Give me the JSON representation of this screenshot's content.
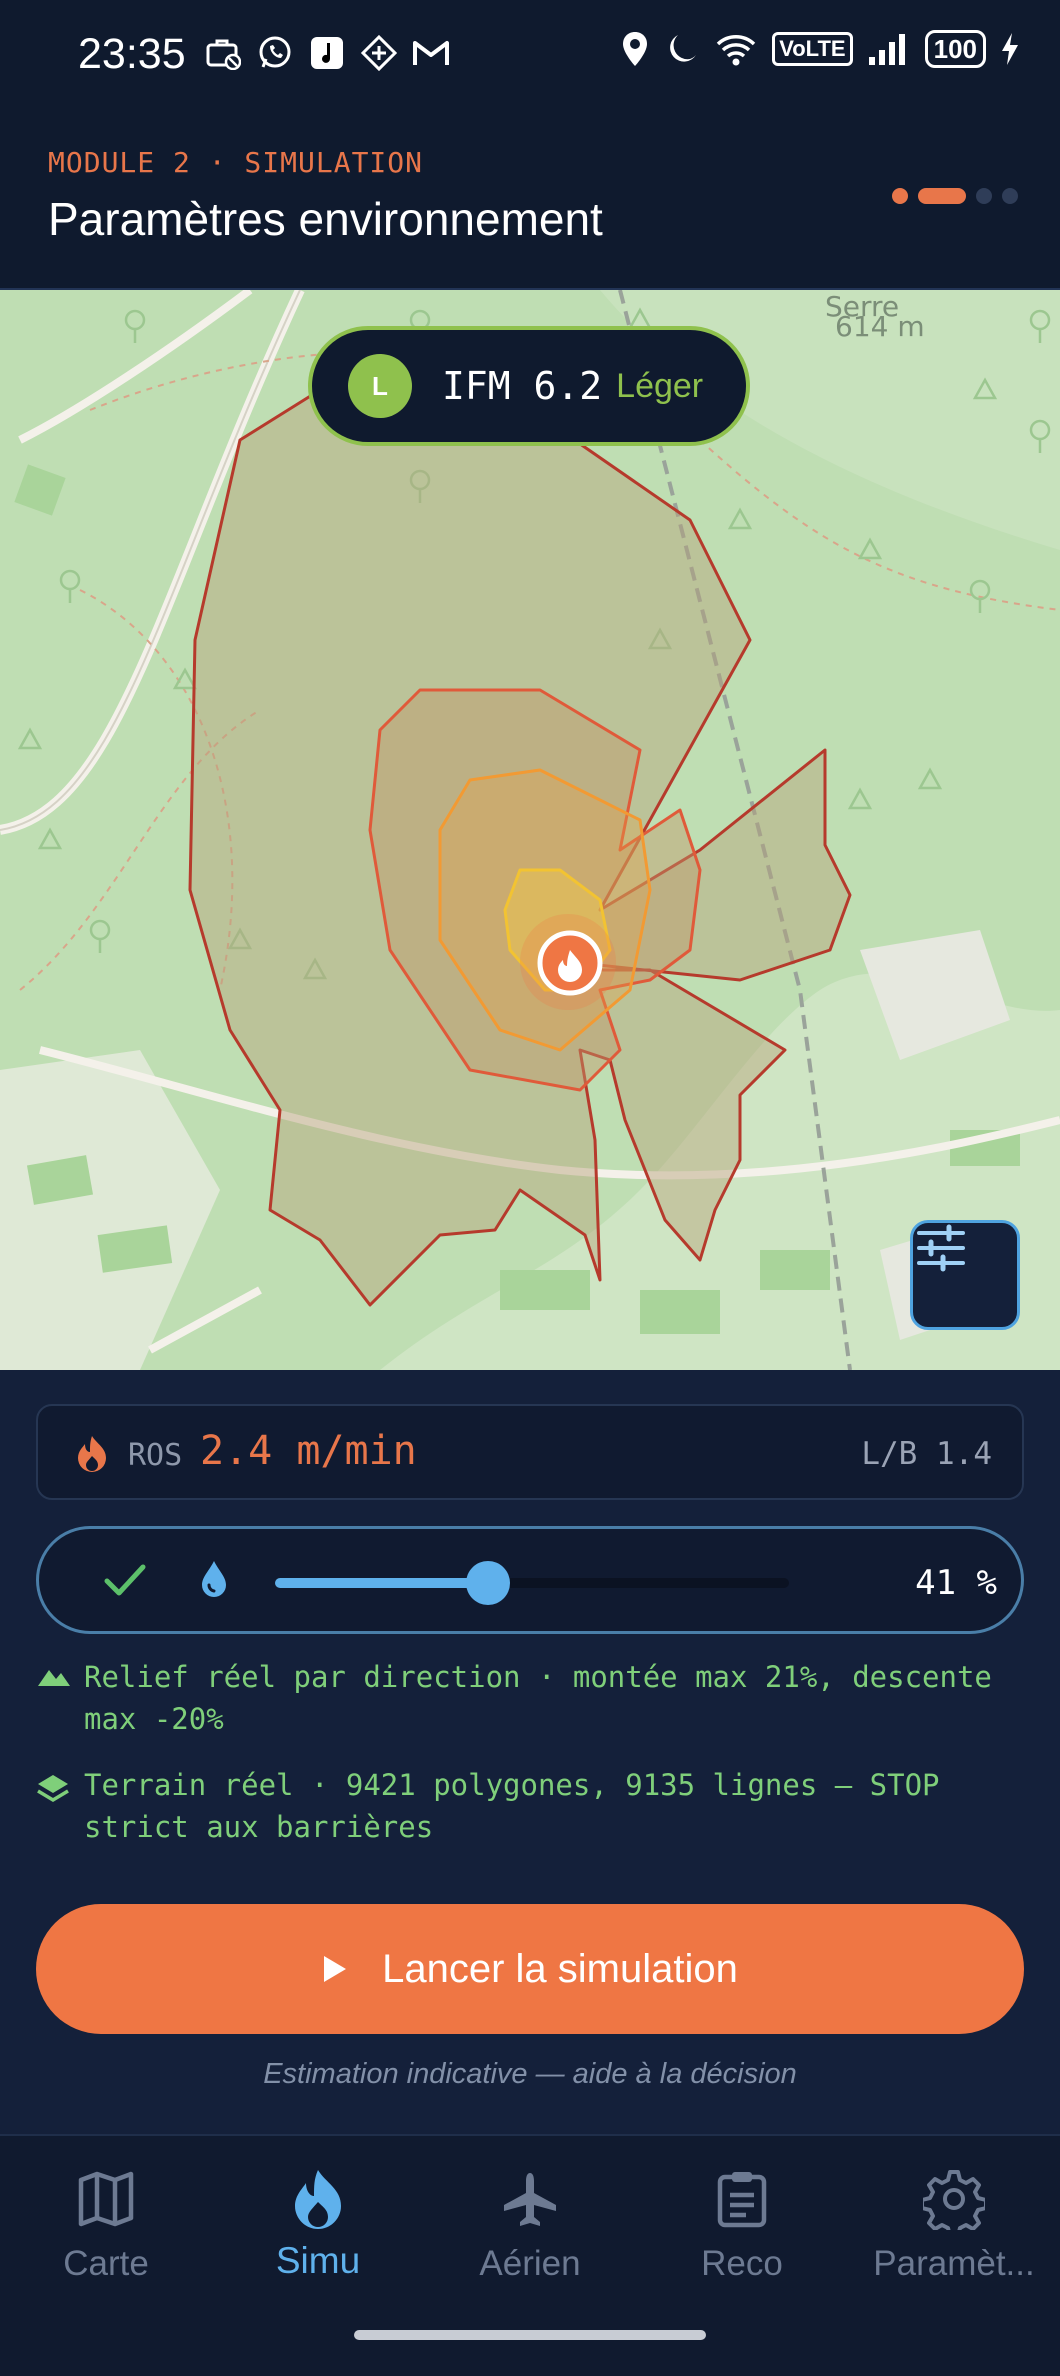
{
  "status_bar": {
    "time": "23:35",
    "left_icons": [
      "briefcase-off-icon",
      "whatsapp-icon",
      "music-app-icon",
      "sim-app-icon",
      "gmail-icon"
    ],
    "volte_label": "VoLTE",
    "battery": "100"
  },
  "header": {
    "module_label": "MODULE 2 · SIMULATION",
    "title": "Paramètres environnement",
    "steps": {
      "total": 4,
      "current": 2
    }
  },
  "map": {
    "place_name": "Serre",
    "altitude": "614 m",
    "ifm": {
      "badge": "L",
      "value": "IFM 6.2",
      "level": "Léger",
      "color": "#8fc14d"
    }
  },
  "ros": {
    "label": "ROS",
    "value": "2.4 m/min",
    "lb": "L/B 1.4",
    "color": "#e8764a"
  },
  "humidity": {
    "value_pct": 41,
    "display": "41 %"
  },
  "info": {
    "relief": "Relief réel par direction · montée max 21%, descente max -20%",
    "terrain": "Terrain réel · 9421 polygones, 9135 lignes — STOP strict aux barrières"
  },
  "launch_label": "Lancer la simulation",
  "disclaimer": "Estimation indicative — aide à la décision",
  "nav": [
    {
      "label": "Carte",
      "icon": "map-icon"
    },
    {
      "label": "Simu",
      "icon": "flame-icon",
      "active": true
    },
    {
      "label": "Aérien",
      "icon": "airplane-icon"
    },
    {
      "label": "Reco",
      "icon": "clipboard-icon"
    },
    {
      "label": "Paramèt...",
      "icon": "gear-icon"
    }
  ],
  "colors": {
    "accent": "#ef7644",
    "primary_blue": "#5fb1ec",
    "success_green": "#7fcf7a",
    "background": "#14203a"
  }
}
